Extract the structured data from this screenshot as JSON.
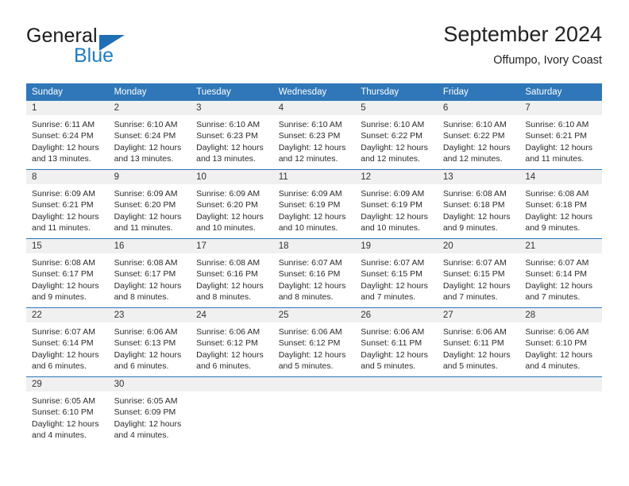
{
  "brand": {
    "name_part1": "General",
    "name_part2": "Blue",
    "triangle_icon": "triangle-icon",
    "accent_color": "#1f7ec4"
  },
  "header": {
    "title": "September 2024",
    "subtitle": "Offumpo, Ivory Coast"
  },
  "colors": {
    "header_blue": "#2f77b8",
    "daynum_gray": "#f0f0f0",
    "text": "#2b2b2b"
  },
  "calendar": {
    "weekday_headers": [
      "Sunday",
      "Monday",
      "Tuesday",
      "Wednesday",
      "Thursday",
      "Friday",
      "Saturday"
    ],
    "weeks": [
      [
        {
          "day": "1",
          "sunrise": "Sunrise: 6:11 AM",
          "sunset": "Sunset: 6:24 PM",
          "daylight_1": "Daylight: 12 hours",
          "daylight_2": "and 13 minutes."
        },
        {
          "day": "2",
          "sunrise": "Sunrise: 6:10 AM",
          "sunset": "Sunset: 6:24 PM",
          "daylight_1": "Daylight: 12 hours",
          "daylight_2": "and 13 minutes."
        },
        {
          "day": "3",
          "sunrise": "Sunrise: 6:10 AM",
          "sunset": "Sunset: 6:23 PM",
          "daylight_1": "Daylight: 12 hours",
          "daylight_2": "and 13 minutes."
        },
        {
          "day": "4",
          "sunrise": "Sunrise: 6:10 AM",
          "sunset": "Sunset: 6:23 PM",
          "daylight_1": "Daylight: 12 hours",
          "daylight_2": "and 12 minutes."
        },
        {
          "day": "5",
          "sunrise": "Sunrise: 6:10 AM",
          "sunset": "Sunset: 6:22 PM",
          "daylight_1": "Daylight: 12 hours",
          "daylight_2": "and 12 minutes."
        },
        {
          "day": "6",
          "sunrise": "Sunrise: 6:10 AM",
          "sunset": "Sunset: 6:22 PM",
          "daylight_1": "Daylight: 12 hours",
          "daylight_2": "and 12 minutes."
        },
        {
          "day": "7",
          "sunrise": "Sunrise: 6:10 AM",
          "sunset": "Sunset: 6:21 PM",
          "daylight_1": "Daylight: 12 hours",
          "daylight_2": "and 11 minutes."
        }
      ],
      [
        {
          "day": "8",
          "sunrise": "Sunrise: 6:09 AM",
          "sunset": "Sunset: 6:21 PM",
          "daylight_1": "Daylight: 12 hours",
          "daylight_2": "and 11 minutes."
        },
        {
          "day": "9",
          "sunrise": "Sunrise: 6:09 AM",
          "sunset": "Sunset: 6:20 PM",
          "daylight_1": "Daylight: 12 hours",
          "daylight_2": "and 11 minutes."
        },
        {
          "day": "10",
          "sunrise": "Sunrise: 6:09 AM",
          "sunset": "Sunset: 6:20 PM",
          "daylight_1": "Daylight: 12 hours",
          "daylight_2": "and 10 minutes."
        },
        {
          "day": "11",
          "sunrise": "Sunrise: 6:09 AM",
          "sunset": "Sunset: 6:19 PM",
          "daylight_1": "Daylight: 12 hours",
          "daylight_2": "and 10 minutes."
        },
        {
          "day": "12",
          "sunrise": "Sunrise: 6:09 AM",
          "sunset": "Sunset: 6:19 PM",
          "daylight_1": "Daylight: 12 hours",
          "daylight_2": "and 10 minutes."
        },
        {
          "day": "13",
          "sunrise": "Sunrise: 6:08 AM",
          "sunset": "Sunset: 6:18 PM",
          "daylight_1": "Daylight: 12 hours",
          "daylight_2": "and 9 minutes."
        },
        {
          "day": "14",
          "sunrise": "Sunrise: 6:08 AM",
          "sunset": "Sunset: 6:18 PM",
          "daylight_1": "Daylight: 12 hours",
          "daylight_2": "and 9 minutes."
        }
      ],
      [
        {
          "day": "15",
          "sunrise": "Sunrise: 6:08 AM",
          "sunset": "Sunset: 6:17 PM",
          "daylight_1": "Daylight: 12 hours",
          "daylight_2": "and 9 minutes."
        },
        {
          "day": "16",
          "sunrise": "Sunrise: 6:08 AM",
          "sunset": "Sunset: 6:17 PM",
          "daylight_1": "Daylight: 12 hours",
          "daylight_2": "and 8 minutes."
        },
        {
          "day": "17",
          "sunrise": "Sunrise: 6:08 AM",
          "sunset": "Sunset: 6:16 PM",
          "daylight_1": "Daylight: 12 hours",
          "daylight_2": "and 8 minutes."
        },
        {
          "day": "18",
          "sunrise": "Sunrise: 6:07 AM",
          "sunset": "Sunset: 6:16 PM",
          "daylight_1": "Daylight: 12 hours",
          "daylight_2": "and 8 minutes."
        },
        {
          "day": "19",
          "sunrise": "Sunrise: 6:07 AM",
          "sunset": "Sunset: 6:15 PM",
          "daylight_1": "Daylight: 12 hours",
          "daylight_2": "and 7 minutes."
        },
        {
          "day": "20",
          "sunrise": "Sunrise: 6:07 AM",
          "sunset": "Sunset: 6:15 PM",
          "daylight_1": "Daylight: 12 hours",
          "daylight_2": "and 7 minutes."
        },
        {
          "day": "21",
          "sunrise": "Sunrise: 6:07 AM",
          "sunset": "Sunset: 6:14 PM",
          "daylight_1": "Daylight: 12 hours",
          "daylight_2": "and 7 minutes."
        }
      ],
      [
        {
          "day": "22",
          "sunrise": "Sunrise: 6:07 AM",
          "sunset": "Sunset: 6:14 PM",
          "daylight_1": "Daylight: 12 hours",
          "daylight_2": "and 6 minutes."
        },
        {
          "day": "23",
          "sunrise": "Sunrise: 6:06 AM",
          "sunset": "Sunset: 6:13 PM",
          "daylight_1": "Daylight: 12 hours",
          "daylight_2": "and 6 minutes."
        },
        {
          "day": "24",
          "sunrise": "Sunrise: 6:06 AM",
          "sunset": "Sunset: 6:12 PM",
          "daylight_1": "Daylight: 12 hours",
          "daylight_2": "and 6 minutes."
        },
        {
          "day": "25",
          "sunrise": "Sunrise: 6:06 AM",
          "sunset": "Sunset: 6:12 PM",
          "daylight_1": "Daylight: 12 hours",
          "daylight_2": "and 5 minutes."
        },
        {
          "day": "26",
          "sunrise": "Sunrise: 6:06 AM",
          "sunset": "Sunset: 6:11 PM",
          "daylight_1": "Daylight: 12 hours",
          "daylight_2": "and 5 minutes."
        },
        {
          "day": "27",
          "sunrise": "Sunrise: 6:06 AM",
          "sunset": "Sunset: 6:11 PM",
          "daylight_1": "Daylight: 12 hours",
          "daylight_2": "and 5 minutes."
        },
        {
          "day": "28",
          "sunrise": "Sunrise: 6:06 AM",
          "sunset": "Sunset: 6:10 PM",
          "daylight_1": "Daylight: 12 hours",
          "daylight_2": "and 4 minutes."
        }
      ],
      [
        {
          "day": "29",
          "sunrise": "Sunrise: 6:05 AM",
          "sunset": "Sunset: 6:10 PM",
          "daylight_1": "Daylight: 12 hours",
          "daylight_2": "and 4 minutes."
        },
        {
          "day": "30",
          "sunrise": "Sunrise: 6:05 AM",
          "sunset": "Sunset: 6:09 PM",
          "daylight_1": "Daylight: 12 hours",
          "daylight_2": "and 4 minutes."
        },
        {
          "day": "",
          "sunrise": "",
          "sunset": "",
          "daylight_1": "",
          "daylight_2": ""
        },
        {
          "day": "",
          "sunrise": "",
          "sunset": "",
          "daylight_1": "",
          "daylight_2": ""
        },
        {
          "day": "",
          "sunrise": "",
          "sunset": "",
          "daylight_1": "",
          "daylight_2": ""
        },
        {
          "day": "",
          "sunrise": "",
          "sunset": "",
          "daylight_1": "",
          "daylight_2": ""
        },
        {
          "day": "",
          "sunrise": "",
          "sunset": "",
          "daylight_1": "",
          "daylight_2": ""
        }
      ]
    ]
  }
}
